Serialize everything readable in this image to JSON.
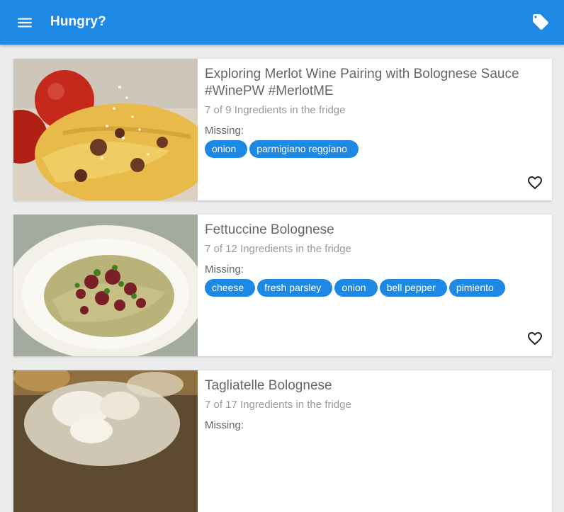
{
  "appbar": {
    "title": "Hungry?",
    "menu_icon": "menu-icon",
    "tag_icon": "tag-icon",
    "color": "#1e88e5"
  },
  "recipes": [
    {
      "title": "Exploring Merlot Wine Pairing with Bolognese Sauce #WinePW #MerlotME",
      "ingredients_info": "7 of 9 Ingredients in the fridge",
      "missing_label": "Missing:",
      "missing": [
        "onion",
        "parmigiano reggiano"
      ],
      "favorite_icon": "heart-outline-icon"
    },
    {
      "title": "Fettuccine Bolognese",
      "ingredients_info": "7 of 12 Ingredients in the fridge",
      "missing_label": "Missing:",
      "missing": [
        "cheese",
        "fresh parsley",
        "onion",
        "bell pepper",
        "pimiento"
      ],
      "favorite_icon": "heart-outline-icon"
    },
    {
      "title": "Tagliatelle Bolognese",
      "ingredients_info": "7 of 17 Ingredients in the fridge",
      "missing_label": "Missing:",
      "missing": [],
      "favorite_icon": "heart-outline-icon"
    }
  ]
}
